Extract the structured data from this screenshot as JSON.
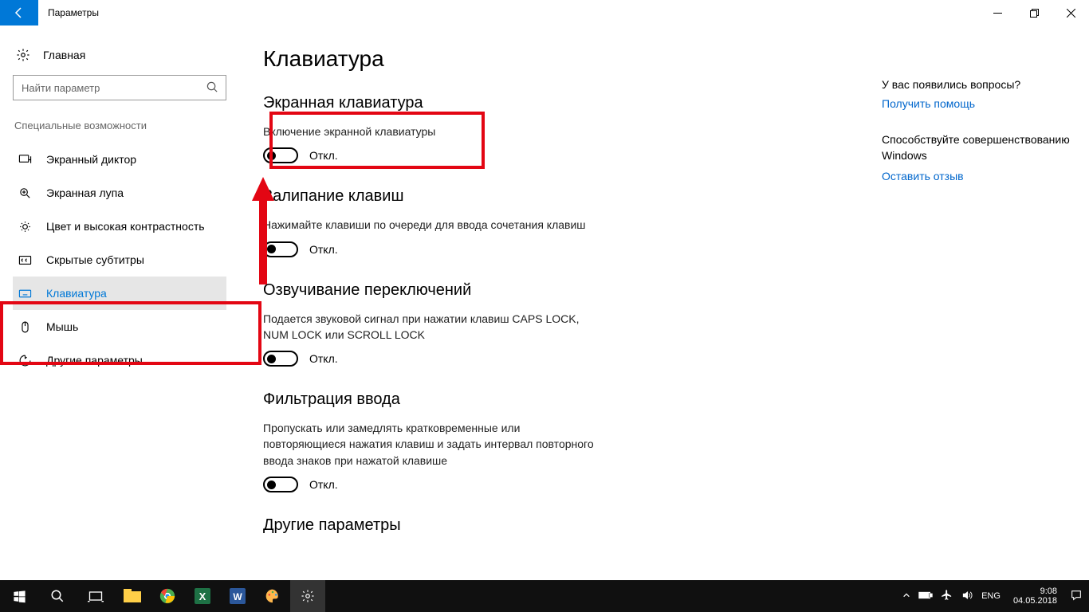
{
  "window": {
    "title": "Параметры"
  },
  "sidebar": {
    "home": "Главная",
    "search_placeholder": "Найти параметр",
    "group": "Специальные возможности",
    "items": [
      {
        "label": "Экранный диктор"
      },
      {
        "label": "Экранная лупа"
      },
      {
        "label": "Цвет и высокая контрастность"
      },
      {
        "label": "Скрытые субтитры"
      },
      {
        "label": "Клавиатура"
      },
      {
        "label": "Мышь"
      },
      {
        "label": "Другие параметры"
      }
    ]
  },
  "main": {
    "page_title": "Клавиатура",
    "s1": {
      "h": "Экранная клавиатура",
      "d": "Включение экранной клавиатуры",
      "state": "Откл."
    },
    "s2": {
      "h": "Залипание клавиш",
      "d": "Нажимайте клавиши по очереди для ввода сочетания клавиш",
      "state": "Откл."
    },
    "s3": {
      "h": "Озвучивание переключений",
      "d": "Подается звуковой сигнал при нажатии клавиш CAPS LOCK, NUM LOCK или SCROLL LOCK",
      "state": "Откл."
    },
    "s4": {
      "h": "Фильтрация ввода",
      "d": "Пропускать или замедлять кратковременные или повторяющиеся нажатия клавиш и задать интервал повторного ввода знаков при нажатой клавише",
      "state": "Откл."
    },
    "s5": {
      "h": "Другие параметры"
    }
  },
  "right": {
    "q1": "У вас появились вопросы?",
    "a1": "Получить помощь",
    "q2": "Способствуйте совершенствованию Windows",
    "a2": "Оставить отзыв"
  },
  "taskbar": {
    "lang": "ENG",
    "time": "9:08",
    "date": "04.05.2018"
  }
}
